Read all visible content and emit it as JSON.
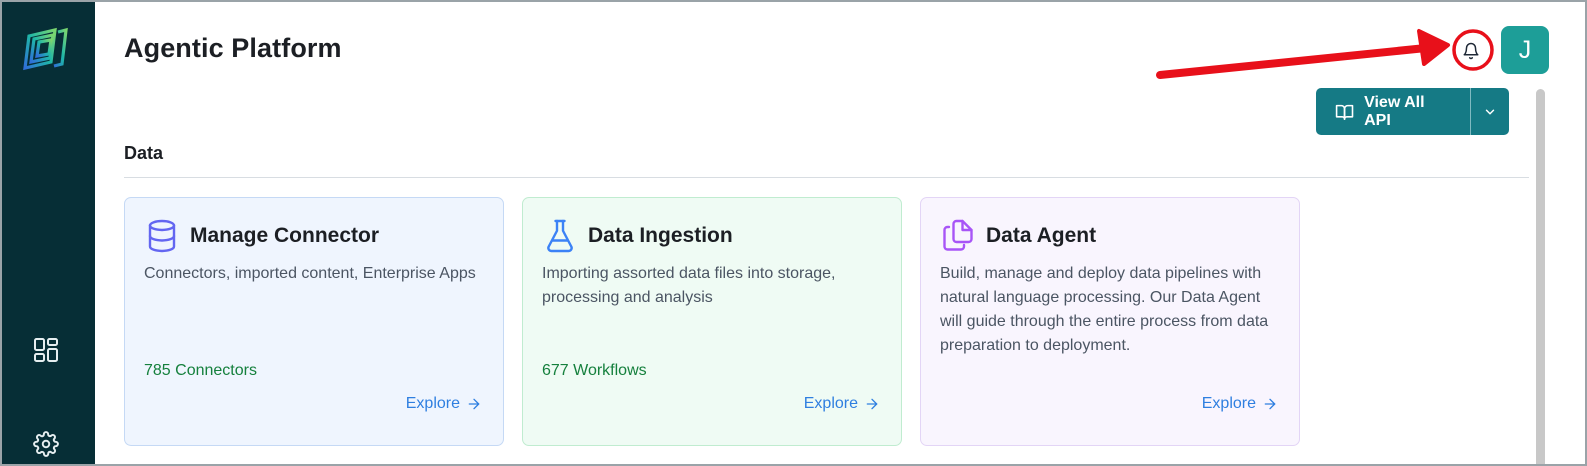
{
  "app": {
    "title": "Agentic Platform",
    "avatar_initial": "J",
    "accent_color": "#157a85",
    "avatar_color": "#1d9e98",
    "sidebar_color": "#062e36"
  },
  "header": {
    "bell_icon": "bell-icon",
    "api_button_label": "View All API",
    "api_button_icon": "book-open-icon",
    "api_dropdown_icon": "chevron-down-icon"
  },
  "sidebar": {
    "items": [
      {
        "icon": "dashboard-icon"
      },
      {
        "icon": "gear-icon"
      }
    ]
  },
  "section": {
    "title": "Data"
  },
  "cards": [
    {
      "title": "Manage Connector",
      "icon": "database-icon",
      "description": "Connectors, imported content, Enterprise Apps",
      "count": "785 Connectors",
      "explore": "Explore"
    },
    {
      "title": "Data Ingestion",
      "icon": "flask-icon",
      "description": "Importing assorted data files into storage, processing and analysis",
      "count": "677 Workflows",
      "explore": "Explore"
    },
    {
      "title": "Data Agent",
      "icon": "files-icon",
      "description": "Build, manage and deploy data pipelines with natural language processing. Our Data Agent will guide through the entire process from data preparation to deployment.",
      "count": "",
      "explore": "Explore"
    }
  ]
}
